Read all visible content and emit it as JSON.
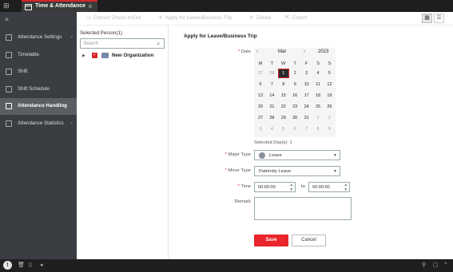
{
  "app": {
    "tab_title": "Time & Attendance"
  },
  "sidebar": {
    "items": [
      {
        "label": "Attendance Settings",
        "expand": "⌄"
      },
      {
        "label": "Timetable",
        "expand": ""
      },
      {
        "label": "Shift",
        "expand": ""
      },
      {
        "label": "Shift Schedule",
        "expand": ""
      },
      {
        "label": "Attendance Handling",
        "expand": ""
      },
      {
        "label": "Attendance Statistics",
        "expand": "⌄"
      }
    ],
    "active_label": "Attendance Handling"
  },
  "toolbar": {
    "correct_label": "Correct Check-In/Out",
    "apply_label": "Apply for Leave/Business Trip",
    "delete_label": "Delete",
    "export_label": "Export"
  },
  "persons": {
    "title": "Selected Person(1)",
    "search_placeholder": "Search",
    "tree_root": "New Organization"
  },
  "form": {
    "title": "Apply for Leave/Business Trip",
    "date_label": "Date",
    "calendar": {
      "prev": "‹",
      "month": "Mar",
      "next": "›",
      "year": "2023",
      "weekdays": [
        "M",
        "T",
        "W",
        "T",
        "F",
        "S",
        "S"
      ],
      "weeks": [
        [
          "27",
          "28",
          "1",
          "2",
          "3",
          "4",
          "5"
        ],
        [
          "6",
          "7",
          "8",
          "9",
          "10",
          "11",
          "12"
        ],
        [
          "13",
          "14",
          "15",
          "16",
          "17",
          "18",
          "19"
        ],
        [
          "20",
          "21",
          "22",
          "23",
          "24",
          "25",
          "26"
        ],
        [
          "27",
          "28",
          "29",
          "30",
          "31",
          "1",
          "2"
        ],
        [
          "3",
          "4",
          "5",
          "6",
          "7",
          "8",
          "9"
        ]
      ],
      "selected": "1"
    },
    "selected_days": "Selected Day(s): 1",
    "major_type_label": "Major Type",
    "major_type_value": "Leave",
    "minor_type_label": "Minor Type",
    "minor_type_value": "Paternity Leave",
    "time_label": "Time",
    "time_from": "00:00:00",
    "time_to_label": "to",
    "time_to": "00:00:00",
    "remark_label": "Remark",
    "save_label": "Save",
    "cancel_label": "Cancel"
  },
  "colors": {
    "accent": "#e8262c",
    "sidebar_bg": "#3a3d42",
    "topbar_bg": "#1e1e1e"
  }
}
